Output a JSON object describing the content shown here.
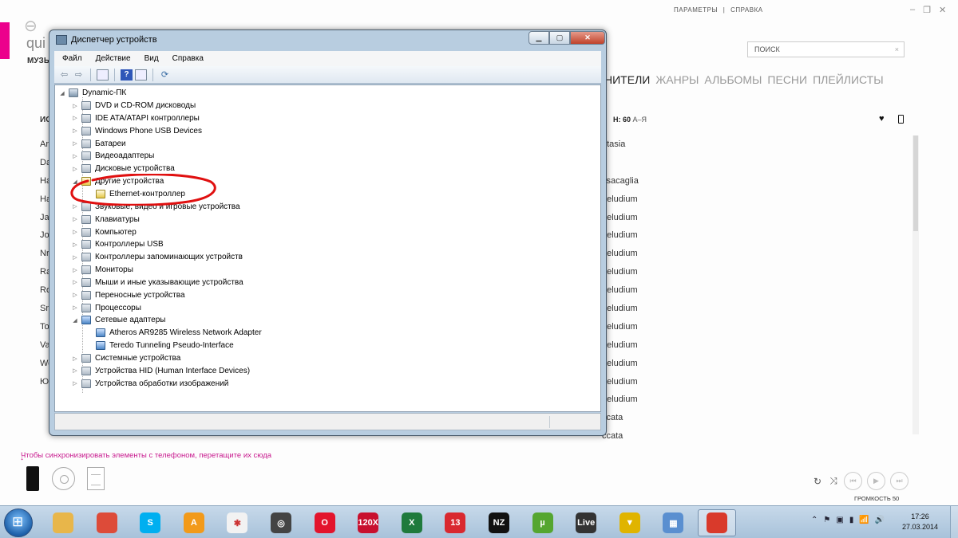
{
  "zune": {
    "title": "qui",
    "subtitle": "МУЗЫ",
    "top_links": [
      "ПАРАМЕТРЫ",
      "|",
      "СПРАВКА"
    ],
    "window_controls": [
      "–",
      "❐",
      "✕"
    ],
    "search_placeholder": "ПОИСК",
    "search_clear": "×",
    "nav_tabs": [
      "НИТЕЛИ",
      "ЖАНРЫ",
      "АЛЬБОМЫ",
      "ПЕСНИ",
      "ПЛЕЙЛИСТЫ"
    ],
    "col_header_left": "ИС",
    "col_header_right_count": "Н: 60",
    "col_header_right_sort": "А–Я",
    "left_items": [
      "Ar",
      "Da",
      "Ha",
      "Ha",
      "Ja",
      "Jo",
      "Nr",
      "Ra",
      "Ro",
      "Sn",
      "To",
      "Va",
      "We",
      "Ю"
    ],
    "right_items": [
      "ntasia",
      "",
      "ssacaglia",
      "aeludium",
      "aeludium",
      "aeludium",
      "aeludium",
      "aeludium",
      "aeludium",
      "aeludium",
      "aeludium",
      "aeludium",
      "aeludium",
      "aeludium",
      "aeludium",
      "ccata",
      "ccata"
    ],
    "sync_hint": "Чтобы синхронизировать элементы с телефоном, перетащите их сюда",
    "volume_label": "ГРОМКОСТЬ 50",
    "player_buttons": [
      "↻",
      "⤨",
      "⏮",
      "▶",
      "⏭"
    ]
  },
  "device_manager": {
    "title": "Диспетчер устройств",
    "menu": [
      "Файл",
      "Действие",
      "Вид",
      "Справка"
    ],
    "toolbar_help": "?",
    "root": "Dynamic-ПК",
    "tree": [
      {
        "label": "DVD и CD-ROM дисководы",
        "level": 1,
        "arrow": "▷",
        "icon": "default"
      },
      {
        "label": "IDE ATA/ATAPI контроллеры",
        "level": 1,
        "arrow": "▷",
        "icon": "default"
      },
      {
        "label": "Windows Phone USB Devices",
        "level": 1,
        "arrow": "▷",
        "icon": "default"
      },
      {
        "label": "Батареи",
        "level": 1,
        "arrow": "▷",
        "icon": "default"
      },
      {
        "label": "Видеоадаптеры",
        "level": 1,
        "arrow": "▷",
        "icon": "default"
      },
      {
        "label": "Дисковые устройства",
        "level": 1,
        "arrow": "▷",
        "icon": "default"
      },
      {
        "label": "Другие устройства",
        "level": 1,
        "arrow": "◢",
        "icon": "warn"
      },
      {
        "label": "Ethernet-контроллер",
        "level": 2,
        "arrow": "",
        "icon": "warn"
      },
      {
        "label": "Звуковые, видео и игровые устройства",
        "level": 1,
        "arrow": "▷",
        "icon": "default"
      },
      {
        "label": "Клавиатуры",
        "level": 1,
        "arrow": "▷",
        "icon": "default"
      },
      {
        "label": "Компьютер",
        "level": 1,
        "arrow": "▷",
        "icon": "default"
      },
      {
        "label": "Контроллеры USB",
        "level": 1,
        "arrow": "▷",
        "icon": "default"
      },
      {
        "label": "Контроллеры запоминающих устройств",
        "level": 1,
        "arrow": "▷",
        "icon": "default"
      },
      {
        "label": "Мониторы",
        "level": 1,
        "arrow": "▷",
        "icon": "default"
      },
      {
        "label": "Мыши и иные указывающие устройства",
        "level": 1,
        "arrow": "▷",
        "icon": "default"
      },
      {
        "label": "Переносные устройства",
        "level": 1,
        "arrow": "▷",
        "icon": "default"
      },
      {
        "label": "Процессоры",
        "level": 1,
        "arrow": "▷",
        "icon": "default"
      },
      {
        "label": "Сетевые адаптеры",
        "level": 1,
        "arrow": "◢",
        "icon": "net"
      },
      {
        "label": "Atheros AR9285 Wireless Network Adapter",
        "level": 2,
        "arrow": "",
        "icon": "net"
      },
      {
        "label": "Teredo Tunneling Pseudo-Interface",
        "level": 2,
        "arrow": "",
        "icon": "net"
      },
      {
        "label": "Системные устройства",
        "level": 1,
        "arrow": "▷",
        "icon": "default"
      },
      {
        "label": "Устройства HID (Human Interface Devices)",
        "level": 1,
        "arrow": "▷",
        "icon": "default"
      },
      {
        "label": "Устройства обработки изображений",
        "level": 1,
        "arrow": "▷",
        "icon": "default"
      }
    ]
  },
  "taskbar": {
    "apps": [
      {
        "name": "explorer",
        "glyph": "",
        "color": "#e8b64a"
      },
      {
        "name": "chrome",
        "glyph": "",
        "color": "#dd4b39"
      },
      {
        "name": "skype",
        "glyph": "S",
        "color": "#00aff0"
      },
      {
        "name": "aimp",
        "glyph": "A",
        "color": "#f29a1a"
      },
      {
        "name": "app-star",
        "glyph": "✱",
        "color": "#f2f2f2"
      },
      {
        "name": "app-circle",
        "glyph": "◎",
        "color": "#444444"
      },
      {
        "name": "opera",
        "glyph": "O",
        "color": "#e3142c"
      },
      {
        "name": "120x",
        "glyph": "120X",
        "color": "#c8102e"
      },
      {
        "name": "excel",
        "glyph": "X",
        "color": "#1f7a3c"
      },
      {
        "name": "app-13",
        "glyph": "13",
        "color": "#d9282f"
      },
      {
        "name": "nz",
        "glyph": "NZ",
        "color": "#111111"
      },
      {
        "name": "utorrent",
        "glyph": "µ",
        "color": "#55a630"
      },
      {
        "name": "live",
        "glyph": "Live",
        "color": "#333333"
      },
      {
        "name": "app-tri",
        "glyph": "▼",
        "color": "#e0b400"
      },
      {
        "name": "control-panel",
        "glyph": "▦",
        "color": "#5a8fd0"
      },
      {
        "name": "device-manager",
        "glyph": "",
        "color": "#d93a2b"
      }
    ],
    "tray": [
      "⌃",
      "⚑",
      "▣",
      "▮",
      "📶",
      "🔊"
    ],
    "time": "17:26",
    "date": "27.03.2014"
  }
}
